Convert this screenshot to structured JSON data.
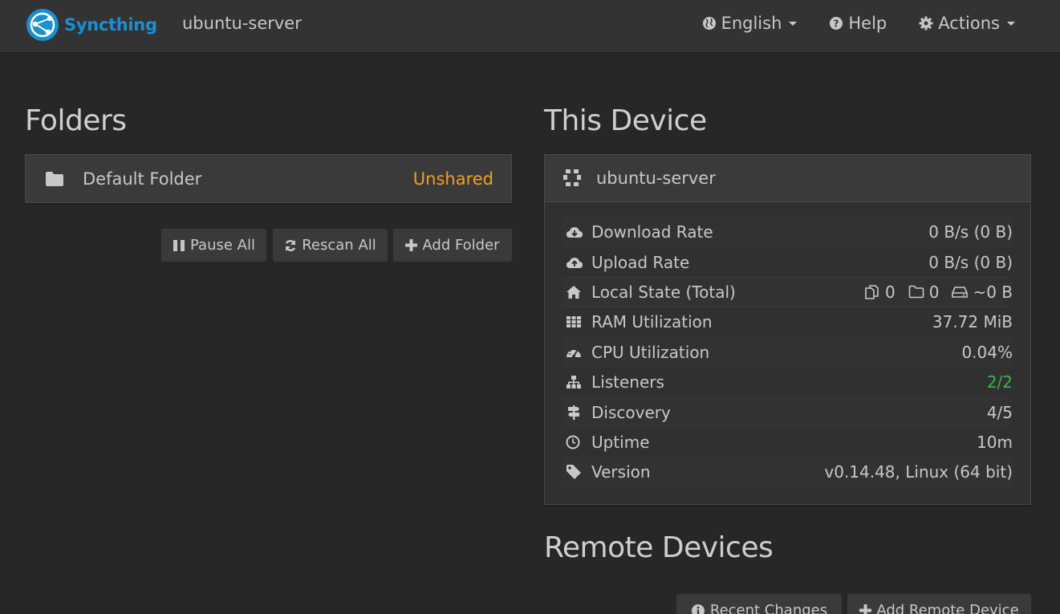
{
  "navbar": {
    "brand": "Syncthing",
    "hostname": "ubuntu-server",
    "language": "English",
    "help": "Help",
    "actions": "Actions"
  },
  "folders": {
    "heading": "Folders",
    "items": [
      {
        "name": "Default Folder",
        "status": "Unshared"
      }
    ],
    "buttons": {
      "pause_all": "Pause All",
      "rescan_all": "Rescan All",
      "add_folder": "Add Folder"
    }
  },
  "this_device": {
    "heading": "This Device",
    "name": "ubuntu-server",
    "stats": {
      "download_rate": {
        "label": "Download Rate",
        "value": "0 B/s (0 B)"
      },
      "upload_rate": {
        "label": "Upload Rate",
        "value": "0 B/s (0 B)"
      },
      "local_state": {
        "label": "Local State (Total)",
        "files": "0",
        "dirs": "0",
        "size": "~0 B"
      },
      "ram": {
        "label": "RAM Utilization",
        "value": "37.72 MiB"
      },
      "cpu": {
        "label": "CPU Utilization",
        "value": "0.04%"
      },
      "listeners": {
        "label": "Listeners",
        "value": "2/2"
      },
      "discovery": {
        "label": "Discovery",
        "value": "4/5"
      },
      "uptime": {
        "label": "Uptime",
        "value": "10m"
      },
      "version": {
        "label": "Version",
        "value": "v0.14.48, Linux (64 bit)"
      }
    }
  },
  "remote_devices": {
    "heading": "Remote Devices",
    "buttons": {
      "recent_changes": "Recent Changes",
      "add_remote_device": "Add Remote Device"
    }
  },
  "colors": {
    "accent": "#1a8fd3",
    "unshared": "#f0a020",
    "ok": "#3cb44a"
  }
}
